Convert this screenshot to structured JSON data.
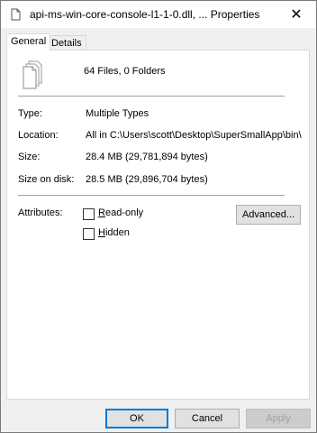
{
  "window": {
    "title": "api-ms-win-core-console-l1-1-0.dll, ... Properties",
    "close_glyph": "✕"
  },
  "tabs": [
    {
      "label": "General",
      "selected": true
    },
    {
      "label": "Details",
      "selected": false
    }
  ],
  "summary": {
    "files_icon": "multiple-files-icon",
    "text": "64 Files, 0 Folders"
  },
  "properties": [
    {
      "label": "Type:",
      "value": "Multiple Types"
    },
    {
      "label": "Location:",
      "value": "All in C:\\Users\\scott\\Desktop\\SuperSmallApp\\bin\\re"
    },
    {
      "label": "Size:",
      "value": "28.4 MB (29,781,894 bytes)"
    },
    {
      "label": "Size on disk:",
      "value": "28.5 MB (29,896,704 bytes)"
    }
  ],
  "attributes": {
    "label": "Attributes:",
    "readonly": {
      "prefix": "",
      "accel": "R",
      "rest": "ead-only",
      "checked": false
    },
    "hidden": {
      "prefix": "",
      "accel": "H",
      "rest": "idden",
      "checked": false
    },
    "advanced_label": "Advanced..."
  },
  "footer": {
    "ok_label": "OK",
    "cancel_label": "Cancel",
    "apply_label": "Apply"
  }
}
